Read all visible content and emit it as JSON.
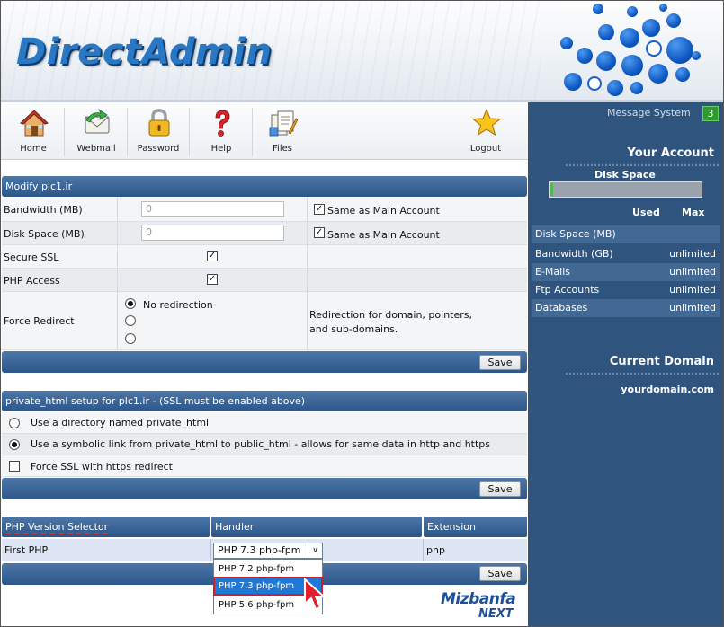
{
  "app": {
    "logo_text": "DirectAdmin"
  },
  "toolbar": {
    "items": [
      {
        "label": "Home",
        "icon": "house-icon"
      },
      {
        "label": "Webmail",
        "icon": "envelope-icon"
      },
      {
        "label": "Password",
        "icon": "padlock-icon"
      },
      {
        "label": "Help",
        "icon": "question-mark-icon"
      },
      {
        "label": "Files",
        "icon": "documents-icon"
      },
      {
        "label": "Logout",
        "icon": "star-icon"
      }
    ]
  },
  "sidebar": {
    "message_system": "Message System",
    "message_count": "3",
    "your_account": "Your Account",
    "disk_space_label": "Disk Space",
    "disk_usage_fraction": 0.01,
    "used_header": "Used",
    "max_header": "Max",
    "stats": [
      {
        "label": "Disk Space (MB)",
        "value": ""
      },
      {
        "label": "Bandwidth (GB)",
        "value": "unlimited"
      },
      {
        "label": "E-Mails",
        "value": "unlimited"
      },
      {
        "label": "Ftp Accounts",
        "value": "unlimited"
      },
      {
        "label": "Databases",
        "value": "unlimited"
      }
    ],
    "current_domain_title": "Current Domain",
    "current_domain": "yourdomain.com"
  },
  "modify": {
    "title": "Modify plc1.ir",
    "bandwidth_label": "Bandwidth (MB)",
    "bandwidth_value": "0",
    "bandwidth_same": "Same as Main Account",
    "disk_label": "Disk Space (MB)",
    "disk_value": "0",
    "disk_same": "Same as Main Account",
    "ssl_label": "Secure SSL",
    "php_label": "PHP Access",
    "redirect_label": "Force Redirect",
    "redirect_option_1": "No redirection",
    "redirect_note_1": "Redirection for domain, pointers,",
    "redirect_note_2": "and sub-domains.",
    "save": "Save"
  },
  "private_html": {
    "title": "private_html setup for plc1.ir - (SSL must be enabled above)",
    "option_1": "Use a directory named private_html",
    "option_2": "Use a symbolic link from private_html to public_html - allows for same data in http and https",
    "force_ssl": "Force SSL with https redirect",
    "save": "Save"
  },
  "php_selector": {
    "col_1": "PHP Version Selector",
    "col_2": "Handler",
    "col_3": "Extension",
    "row_label": "First PHP",
    "selected": "PHP 7.3 php-fpm",
    "extension": "php",
    "options": [
      "PHP 7.2 php-fpm",
      "PHP 7.3 php-fpm",
      "PHP 5.6 php-fpm"
    ],
    "save": "Save"
  },
  "brand": {
    "line_1": "Mizbanfa",
    "line_2": "NEXT"
  }
}
